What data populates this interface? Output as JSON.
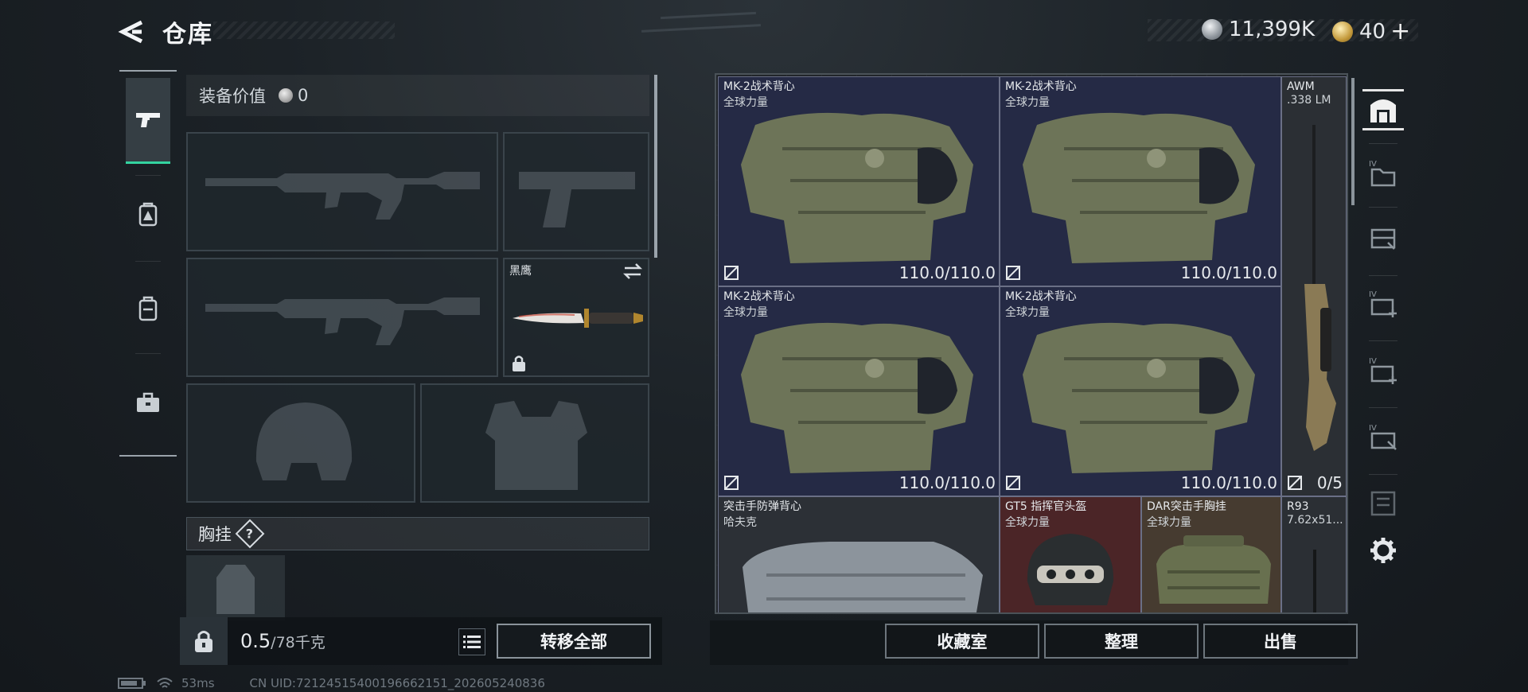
{
  "header": {
    "title": "仓库",
    "silver_amount": "11,399K",
    "gold_amount": "40"
  },
  "left_rail": {
    "items": [
      {
        "icon": "pistol-icon",
        "active": true
      },
      {
        "icon": "backpack-badge-icon",
        "active": false
      },
      {
        "icon": "backpack-icon",
        "active": false
      },
      {
        "icon": "toolbox-icon",
        "active": false
      }
    ]
  },
  "equipment": {
    "value_label": "装备价值",
    "value": "0",
    "melee_name": "黑鹰",
    "chest_rig_label": "胸挂",
    "chest_rig_help": "?",
    "weight_current": "0.5",
    "weight_max": "/78千克",
    "transfer_all_label": "转移全部"
  },
  "storage": {
    "items": [
      {
        "name": "MK-2战术背心",
        "sub": "全球力量",
        "value": "110.0/110.0"
      },
      {
        "name": "MK-2战术背心",
        "sub": "全球力量",
        "value": "110.0/110.0"
      },
      {
        "name": "MK-2战术背心",
        "sub": "全球力量",
        "value": "110.0/110.0"
      },
      {
        "name": "MK-2战术背心",
        "sub": "全球力量",
        "value": "110.0/110.0"
      },
      {
        "name": "AWM",
        "sub": ".338 LM",
        "value": "0/5"
      },
      {
        "name": "突击手防弹背心",
        "sub": "哈夫克"
      },
      {
        "name": "GT5 指挥官头盔",
        "sub": "全球力量"
      },
      {
        "name": "DAR突击手胸挂",
        "sub": "全球力量"
      },
      {
        "name": "R93",
        "sub": "7.62x51..."
      }
    ],
    "buttons": {
      "collection": "收藏室",
      "organize": "整理",
      "sell": "出售"
    }
  },
  "status": {
    "ping": "53ms",
    "uid": "CN UID:72124515400196662151_202605240836"
  },
  "colors": {
    "accent": "#34d3a0",
    "vest_card_bg": "#252a45",
    "helmet_card_bg": "#4b2527",
    "rig_card_bg": "#463b30"
  }
}
